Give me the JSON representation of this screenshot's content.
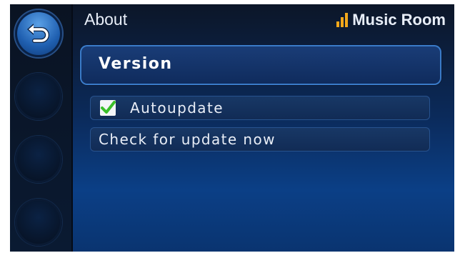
{
  "header": {
    "title": "About",
    "room": "Music Room"
  },
  "icons": {
    "back": "back-arrow-icon",
    "signal": "signal-bars-icon",
    "check": "checkmark-icon"
  },
  "section": {
    "title": "Version"
  },
  "settings": [
    {
      "label": "Autoupdate",
      "checked": true
    },
    {
      "label": "Check for update now"
    }
  ],
  "colors": {
    "accent": "#f3a81b",
    "check": "#3bbf2a",
    "background": "#0b3f86"
  }
}
